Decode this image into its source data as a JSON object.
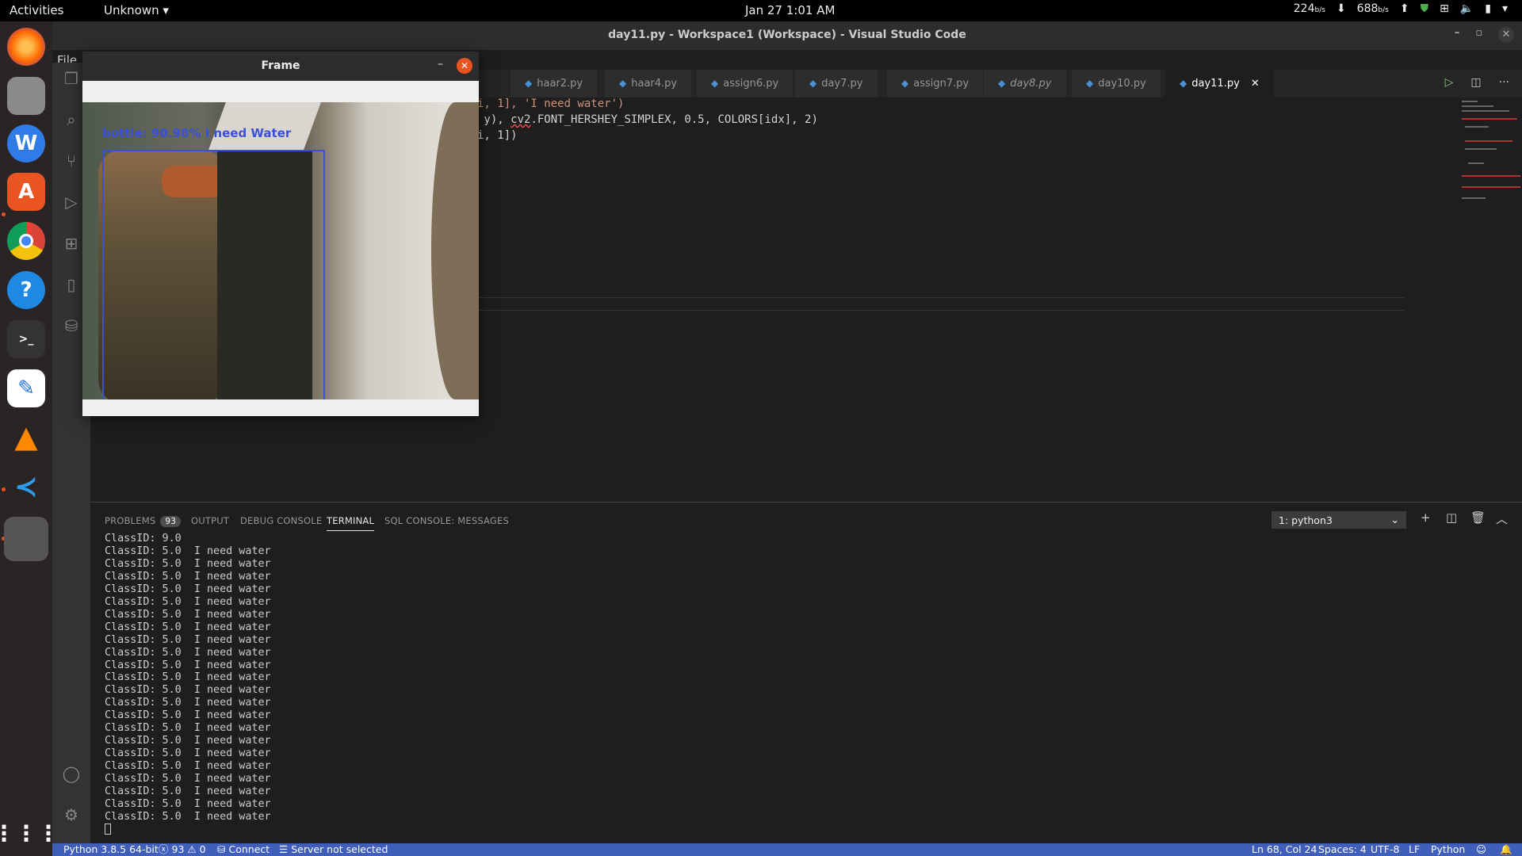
{
  "topbar": {
    "activities": "Activities",
    "app_menu": "Unknown",
    "clock": "Jan 27  1:01 AM",
    "net_down": "224",
    "net_down_unit": "b/s",
    "net_up": "688",
    "net_up_unit": "b/s"
  },
  "dock": {
    "items": [
      "firefox-icon",
      "files-icon",
      "wps-writer-icon",
      "software-center-icon",
      "chrome-icon",
      "help-icon",
      "terminal-icon",
      "text-editor-icon",
      "vlc-icon",
      "vscode-icon",
      "show-apps-icon"
    ]
  },
  "window": {
    "title": "day11.py - Workspace1 (Workspace) - Visual Studio Code",
    "menu_file": "File"
  },
  "tabs": [
    {
      "label": "haar2.py",
      "active": false,
      "italic": false
    },
    {
      "label": "haar4.py",
      "active": false,
      "italic": false
    },
    {
      "label": "assign6.py",
      "active": false,
      "italic": false
    },
    {
      "label": "day7.py",
      "active": false,
      "italic": false
    },
    {
      "label": "assign7.py",
      "active": false,
      "italic": false
    },
    {
      "label": "day8.py",
      "active": false,
      "italic": true
    },
    {
      "label": "day10.py",
      "active": false,
      "italic": false
    },
    {
      "label": "day11.py",
      "active": true,
      "italic": false
    }
  ],
  "editor": {
    "line1": "i, 1], 'I need water')",
    "line2_a": " y), ",
    "line2_b": "cv2",
    "line2_c": ".FONT_HERSHEY_SIMPLEX, 0.5, COLORS[idx], 2)",
    "line3": "i, 1])"
  },
  "panel": {
    "tabs": {
      "problems": "PROBLEMS",
      "problems_count": "93",
      "output": "OUTPUT",
      "debug": "DEBUG CONSOLE",
      "terminal": "TERMINAL",
      "sql": "SQL CONSOLE: MESSAGES"
    },
    "terminal_select": "1: python3",
    "terminal_lines": [
      "ClassID: 9.0",
      "ClassID: 5.0  I need water",
      "ClassID: 5.0  I need water",
      "ClassID: 5.0  I need water",
      "ClassID: 5.0  I need water",
      "ClassID: 5.0  I need water",
      "ClassID: 5.0  I need water",
      "ClassID: 5.0  I need water",
      "ClassID: 5.0  I need water",
      "ClassID: 5.0  I need water",
      "ClassID: 5.0  I need water",
      "ClassID: 5.0  I need water",
      "ClassID: 5.0  I need water",
      "ClassID: 5.0  I need water",
      "ClassID: 5.0  I need water",
      "ClassID: 5.0  I need water",
      "ClassID: 5.0  I need water",
      "ClassID: 5.0  I need water",
      "ClassID: 5.0  I need water",
      "ClassID: 5.0  I need water",
      "ClassID: 5.0  I need water",
      "ClassID: 5.0  I need water",
      "ClassID: 5.0  I need water"
    ]
  },
  "statusbar": {
    "python": "Python 3.8.5 64-bit",
    "errors": "93",
    "warnings": "0",
    "connect": "Connect",
    "server": "Server not selected",
    "position": "Ln 68, Col 24",
    "spaces": "Spaces: 4",
    "encoding": "UTF-8",
    "eol": "LF",
    "language": "Python"
  },
  "frame_window": {
    "title": "Frame",
    "detection_label": "bottle: 90.98% I need Water"
  }
}
